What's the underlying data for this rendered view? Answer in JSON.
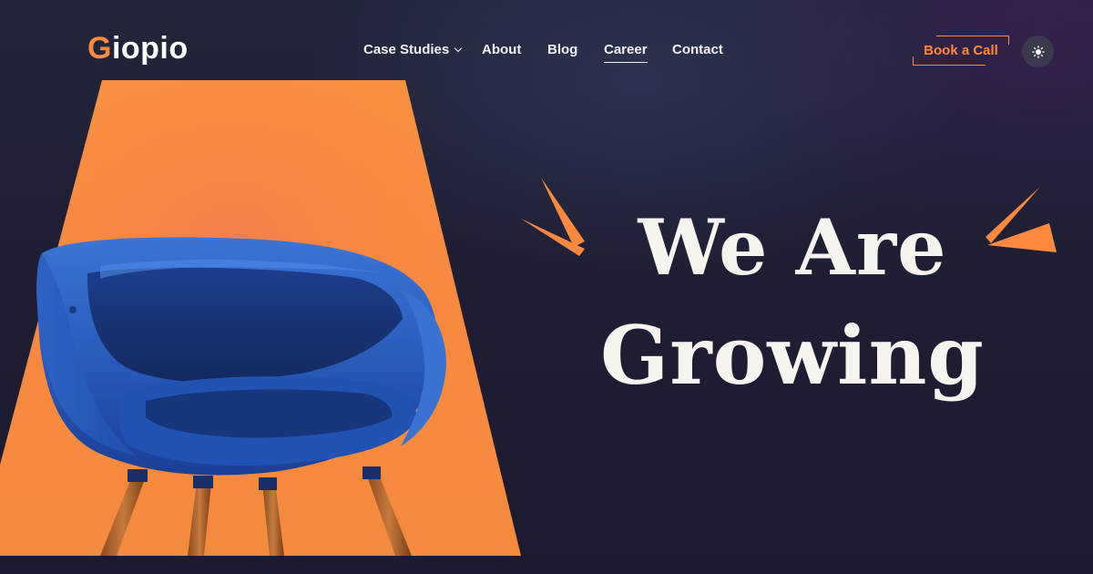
{
  "brand": {
    "logo_first": "G",
    "logo_rest": "iopio",
    "accent": "#ff8a3d"
  },
  "nav": [
    {
      "label": "Case Studies",
      "has_dropdown": true,
      "active": false
    },
    {
      "label": "About",
      "active": false
    },
    {
      "label": "Blog",
      "active": false
    },
    {
      "label": "Career",
      "active": true
    },
    {
      "label": "Contact",
      "active": false
    }
  ],
  "cta": {
    "label": "Book a Call"
  },
  "theme_toggle": {
    "icon": "sun-icon"
  },
  "hero": {
    "line1": "We Are",
    "line2": "Growing",
    "image": "blue-chair-on-orange-trapezoid"
  },
  "colors": {
    "background": "#1f1f32",
    "accent": "#ff8a3d",
    "chair": "#2f63c8"
  }
}
